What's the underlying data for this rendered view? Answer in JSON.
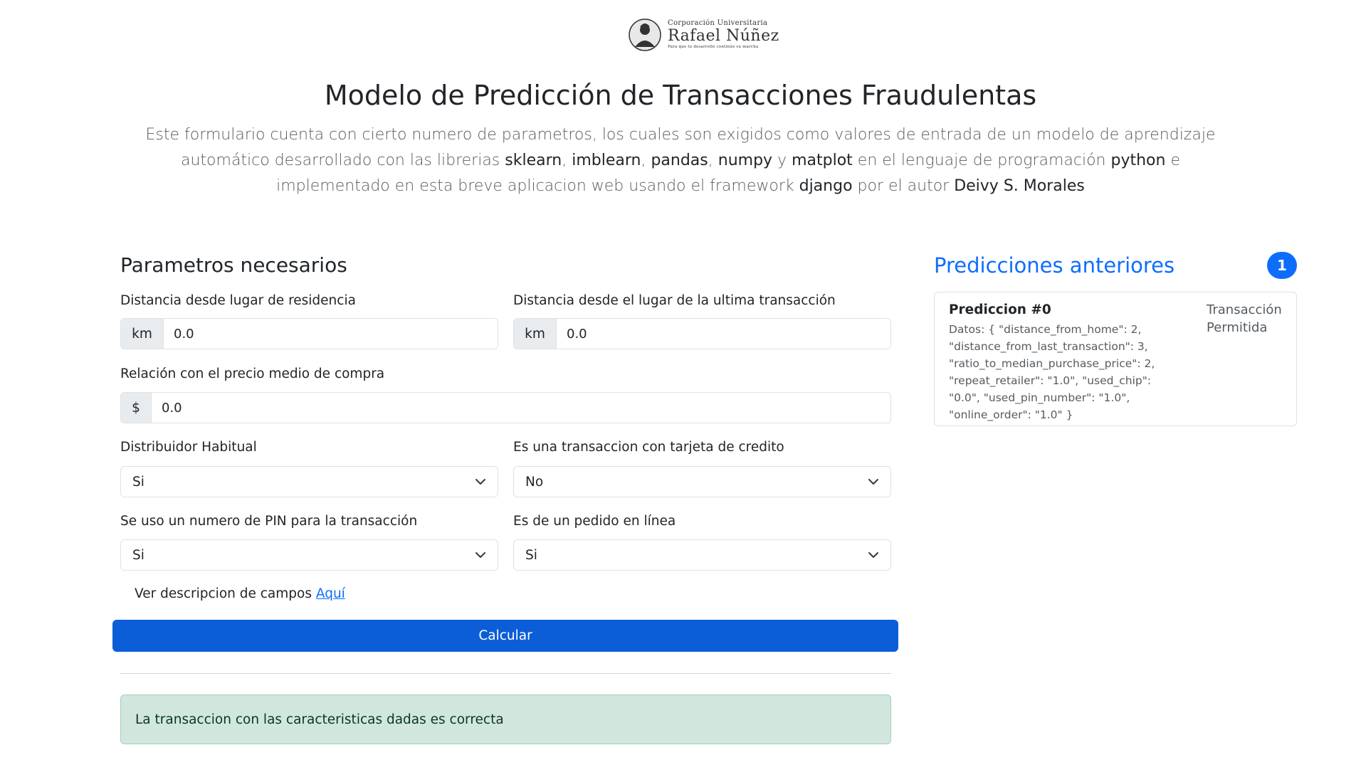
{
  "header": {
    "logo": {
      "line1": "Corporación Universitaria",
      "line2": "Rafael Núñez",
      "tagline": "Para que tu desarrollo continúe su marcha"
    },
    "title": "Modelo de Predicción de Transacciones Fraudulentas",
    "lead": {
      "p1": "Este formulario cuenta con cierto numero de parametros, los cuales son exigidos como valores de entrada de un modelo de aprendizaje automático desarrollado con las librerias ",
      "lib1": "sklearn",
      "sep1": ", ",
      "lib2": "imblearn",
      "sep2": ", ",
      "lib3": "pandas",
      "sep3": ", ",
      "lib4": "numpy",
      "sep4": " y ",
      "lib5": "matplot",
      "p2": " en el lenguaje de programación ",
      "lang": "python",
      "p3": " e implementado en esta breve aplicacion web usando el framework ",
      "framework": "django",
      "p4": " por el autor ",
      "author": "Deivy S. Morales"
    }
  },
  "form": {
    "title": "Parametros necesarios",
    "distance_home": {
      "label": "Distancia desde lugar de residencia",
      "addon": "km",
      "value": "0.0"
    },
    "distance_last": {
      "label": "Distancia desde el lugar de la ultima transacción",
      "addon": "km",
      "value": "0.0"
    },
    "ratio": {
      "label": "Relación con el precio medio de compra",
      "addon": "$",
      "value": "0.0"
    },
    "repeat_retailer": {
      "label": "Distribuidor Habitual",
      "value": "Si"
    },
    "used_chip": {
      "label": "Es una transaccion con tarjeta de credito",
      "value": "No"
    },
    "used_pin": {
      "label": "Se uso un numero de PIN para la transacción",
      "value": "Si"
    },
    "online_order": {
      "label": "Es de un pedido en línea",
      "value": "Si"
    },
    "desc_text": "Ver descripcion de campos ",
    "desc_link": "Aquí",
    "submit_label": "Calcular",
    "result_message": "La transaccion con las caracteristicas dadas es correcta"
  },
  "sidebar": {
    "title": "Predicciones anteriores",
    "count": "1",
    "items": [
      {
        "title": "Prediccion #0",
        "data": "Datos: { \"distance_from_home\": 2, \"distance_from_last_transaction\": 3, \"ratio_to_median_purchase_price\": 2, \"repeat_retailer\": \"1.0\", \"used_chip\": \"0.0\", \"used_pin_number\": \"1.0\", \"online_order\": \"1.0\" }",
        "status": "Transacción Permitida"
      }
    ]
  },
  "icons": {
    "select_arrow": "chevron-down-icon",
    "logo": "university-emblem-icon"
  },
  "colors": {
    "primary": "#0d6efd",
    "button": "#0b5ed7",
    "success_bg": "#d1e7dd"
  }
}
